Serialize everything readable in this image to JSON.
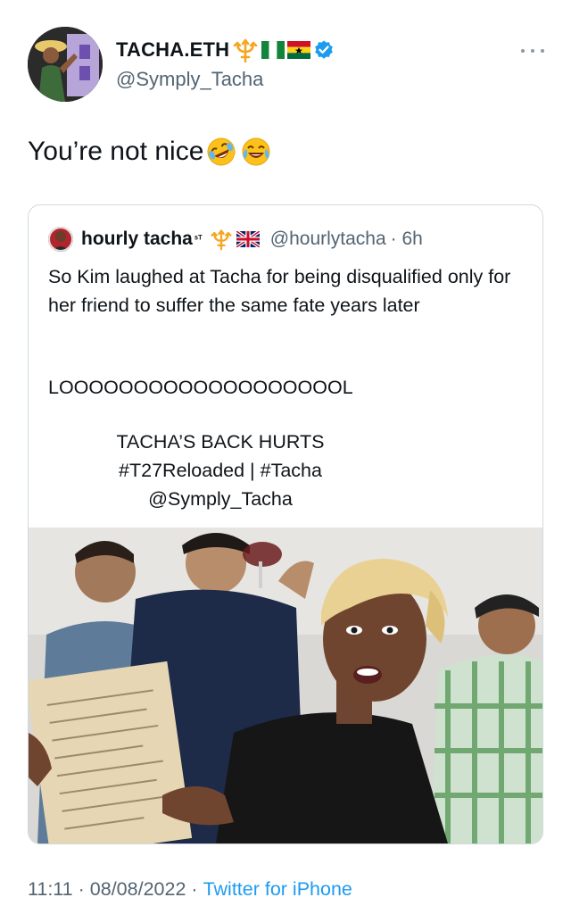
{
  "author": {
    "display_name": "TACHA.ETH",
    "handle": "@Symply_Tacha",
    "verified": true,
    "name_icons": [
      "trident-icon",
      "nigeria-flag-icon",
      "ghana-flag-icon",
      "verified-badge-icon"
    ]
  },
  "tweet": {
    "text": "You’re not nice",
    "emojis": [
      "rolling-on-floor-laughing-emoji",
      "tears-of-joy-emoji"
    ]
  },
  "quoted": {
    "name": "hourly tacha",
    "name_superscript": "ˢᵀ",
    "handle": "@hourlytacha",
    "time": "· 6h",
    "line1": "So Kim laughed at Tacha for being disqualified only for her friend to suffer the same fate years later",
    "line2": "LOOOOOOOOOOOOOOOOOOOL",
    "line3": "TACHA’S BACK HURTS",
    "line4": "#T27Reloaded | #Tacha",
    "line5": "@Symply_Tacha",
    "media": "woman-with-menu-photo"
  },
  "footer": {
    "time": "11:11",
    "sep1": "·",
    "date": "08/08/2022",
    "sep2": "·",
    "source": "Twitter for iPhone"
  },
  "colors": {
    "link_blue": "#1d9bf0",
    "secondary_text": "#536471",
    "border": "#cfd9de"
  }
}
